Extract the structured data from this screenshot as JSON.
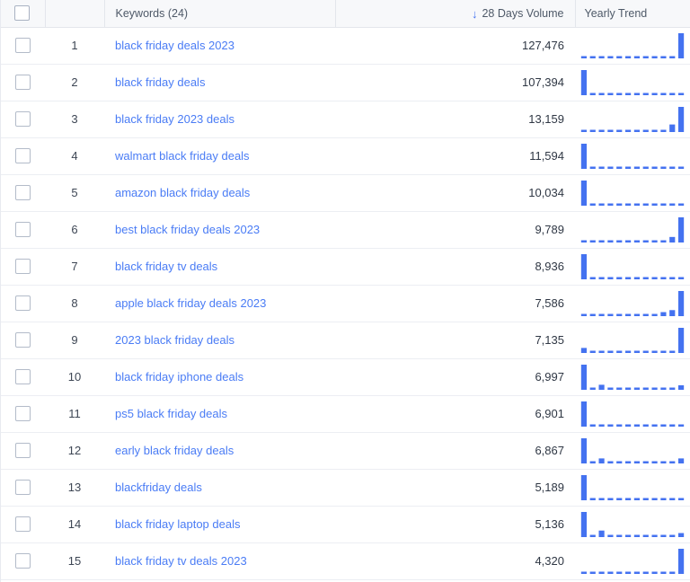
{
  "table": {
    "columns": [
      {
        "key": "select",
        "label": "",
        "icon": "checkbox-icon"
      },
      {
        "key": "rank",
        "label": ""
      },
      {
        "key": "keyword",
        "label": "Keywords (24)"
      },
      {
        "key": "volume",
        "label": "28 Days Volume",
        "sort": "desc",
        "sort_icon": "arrow-down-icon"
      },
      {
        "key": "trend",
        "label": "Yearly Trend"
      }
    ],
    "keyword_count": 24,
    "sort_indicator": "↓",
    "colors": {
      "link": "#4a7cf5",
      "bar": "#4472f0",
      "header_bg": "#f7f8fa",
      "row_border": "#eceef3",
      "text": "#2f3744"
    },
    "rows": [
      {
        "rank": "1",
        "keyword": "black friday deals 2023",
        "volume": "127,476",
        "trend": [
          8,
          8,
          8,
          8,
          8,
          8,
          8,
          8,
          8,
          8,
          8,
          100
        ]
      },
      {
        "rank": "2",
        "keyword": "black friday deals",
        "volume": "107,394",
        "trend": [
          100,
          8,
          8,
          8,
          8,
          8,
          8,
          8,
          8,
          8,
          8,
          8
        ]
      },
      {
        "rank": "3",
        "keyword": "black friday 2023 deals",
        "volume": "13,159",
        "trend": [
          8,
          8,
          8,
          8,
          8,
          8,
          8,
          8,
          8,
          8,
          30,
          100
        ]
      },
      {
        "rank": "4",
        "keyword": "walmart black friday deals",
        "volume": "11,594",
        "trend": [
          100,
          8,
          8,
          8,
          8,
          8,
          8,
          8,
          8,
          8,
          8,
          8
        ]
      },
      {
        "rank": "5",
        "keyword": "amazon black friday deals",
        "volume": "10,034",
        "trend": [
          100,
          8,
          8,
          8,
          8,
          8,
          8,
          8,
          8,
          8,
          8,
          8
        ]
      },
      {
        "rank": "6",
        "keyword": "best black friday deals 2023",
        "volume": "9,789",
        "trend": [
          8,
          8,
          8,
          8,
          8,
          8,
          8,
          8,
          8,
          8,
          22,
          100
        ]
      },
      {
        "rank": "7",
        "keyword": "black friday tv deals",
        "volume": "8,936",
        "trend": [
          100,
          8,
          8,
          8,
          8,
          8,
          8,
          8,
          8,
          8,
          8,
          8
        ]
      },
      {
        "rank": "8",
        "keyword": "apple black friday deals 2023",
        "volume": "7,586",
        "trend": [
          8,
          8,
          8,
          8,
          8,
          8,
          8,
          8,
          8,
          16,
          24,
          100
        ]
      },
      {
        "rank": "9",
        "keyword": "2023 black friday deals",
        "volume": "7,135",
        "trend": [
          20,
          8,
          8,
          8,
          8,
          8,
          8,
          8,
          8,
          8,
          8,
          100
        ]
      },
      {
        "rank": "10",
        "keyword": "black friday iphone deals",
        "volume": "6,997",
        "trend": [
          100,
          8,
          20,
          8,
          8,
          8,
          8,
          8,
          8,
          8,
          8,
          18
        ]
      },
      {
        "rank": "11",
        "keyword": "ps5 black friday deals",
        "volume": "6,901",
        "trend": [
          100,
          8,
          8,
          8,
          8,
          8,
          8,
          8,
          8,
          8,
          8,
          8
        ]
      },
      {
        "rank": "12",
        "keyword": "early black friday deals",
        "volume": "6,867",
        "trend": [
          100,
          8,
          20,
          8,
          8,
          8,
          8,
          8,
          8,
          8,
          8,
          20
        ]
      },
      {
        "rank": "13",
        "keyword": "blackfriday deals",
        "volume": "5,189",
        "trend": [
          100,
          8,
          8,
          8,
          8,
          8,
          8,
          8,
          8,
          8,
          8,
          8
        ]
      },
      {
        "rank": "14",
        "keyword": "black friday laptop deals",
        "volume": "5,136",
        "trend": [
          100,
          8,
          26,
          8,
          8,
          8,
          8,
          8,
          8,
          8,
          8,
          16
        ]
      },
      {
        "rank": "15",
        "keyword": "black friday tv deals 2023",
        "volume": "4,320",
        "trend": [
          8,
          8,
          8,
          8,
          8,
          8,
          8,
          8,
          8,
          8,
          8,
          100
        ]
      }
    ]
  }
}
